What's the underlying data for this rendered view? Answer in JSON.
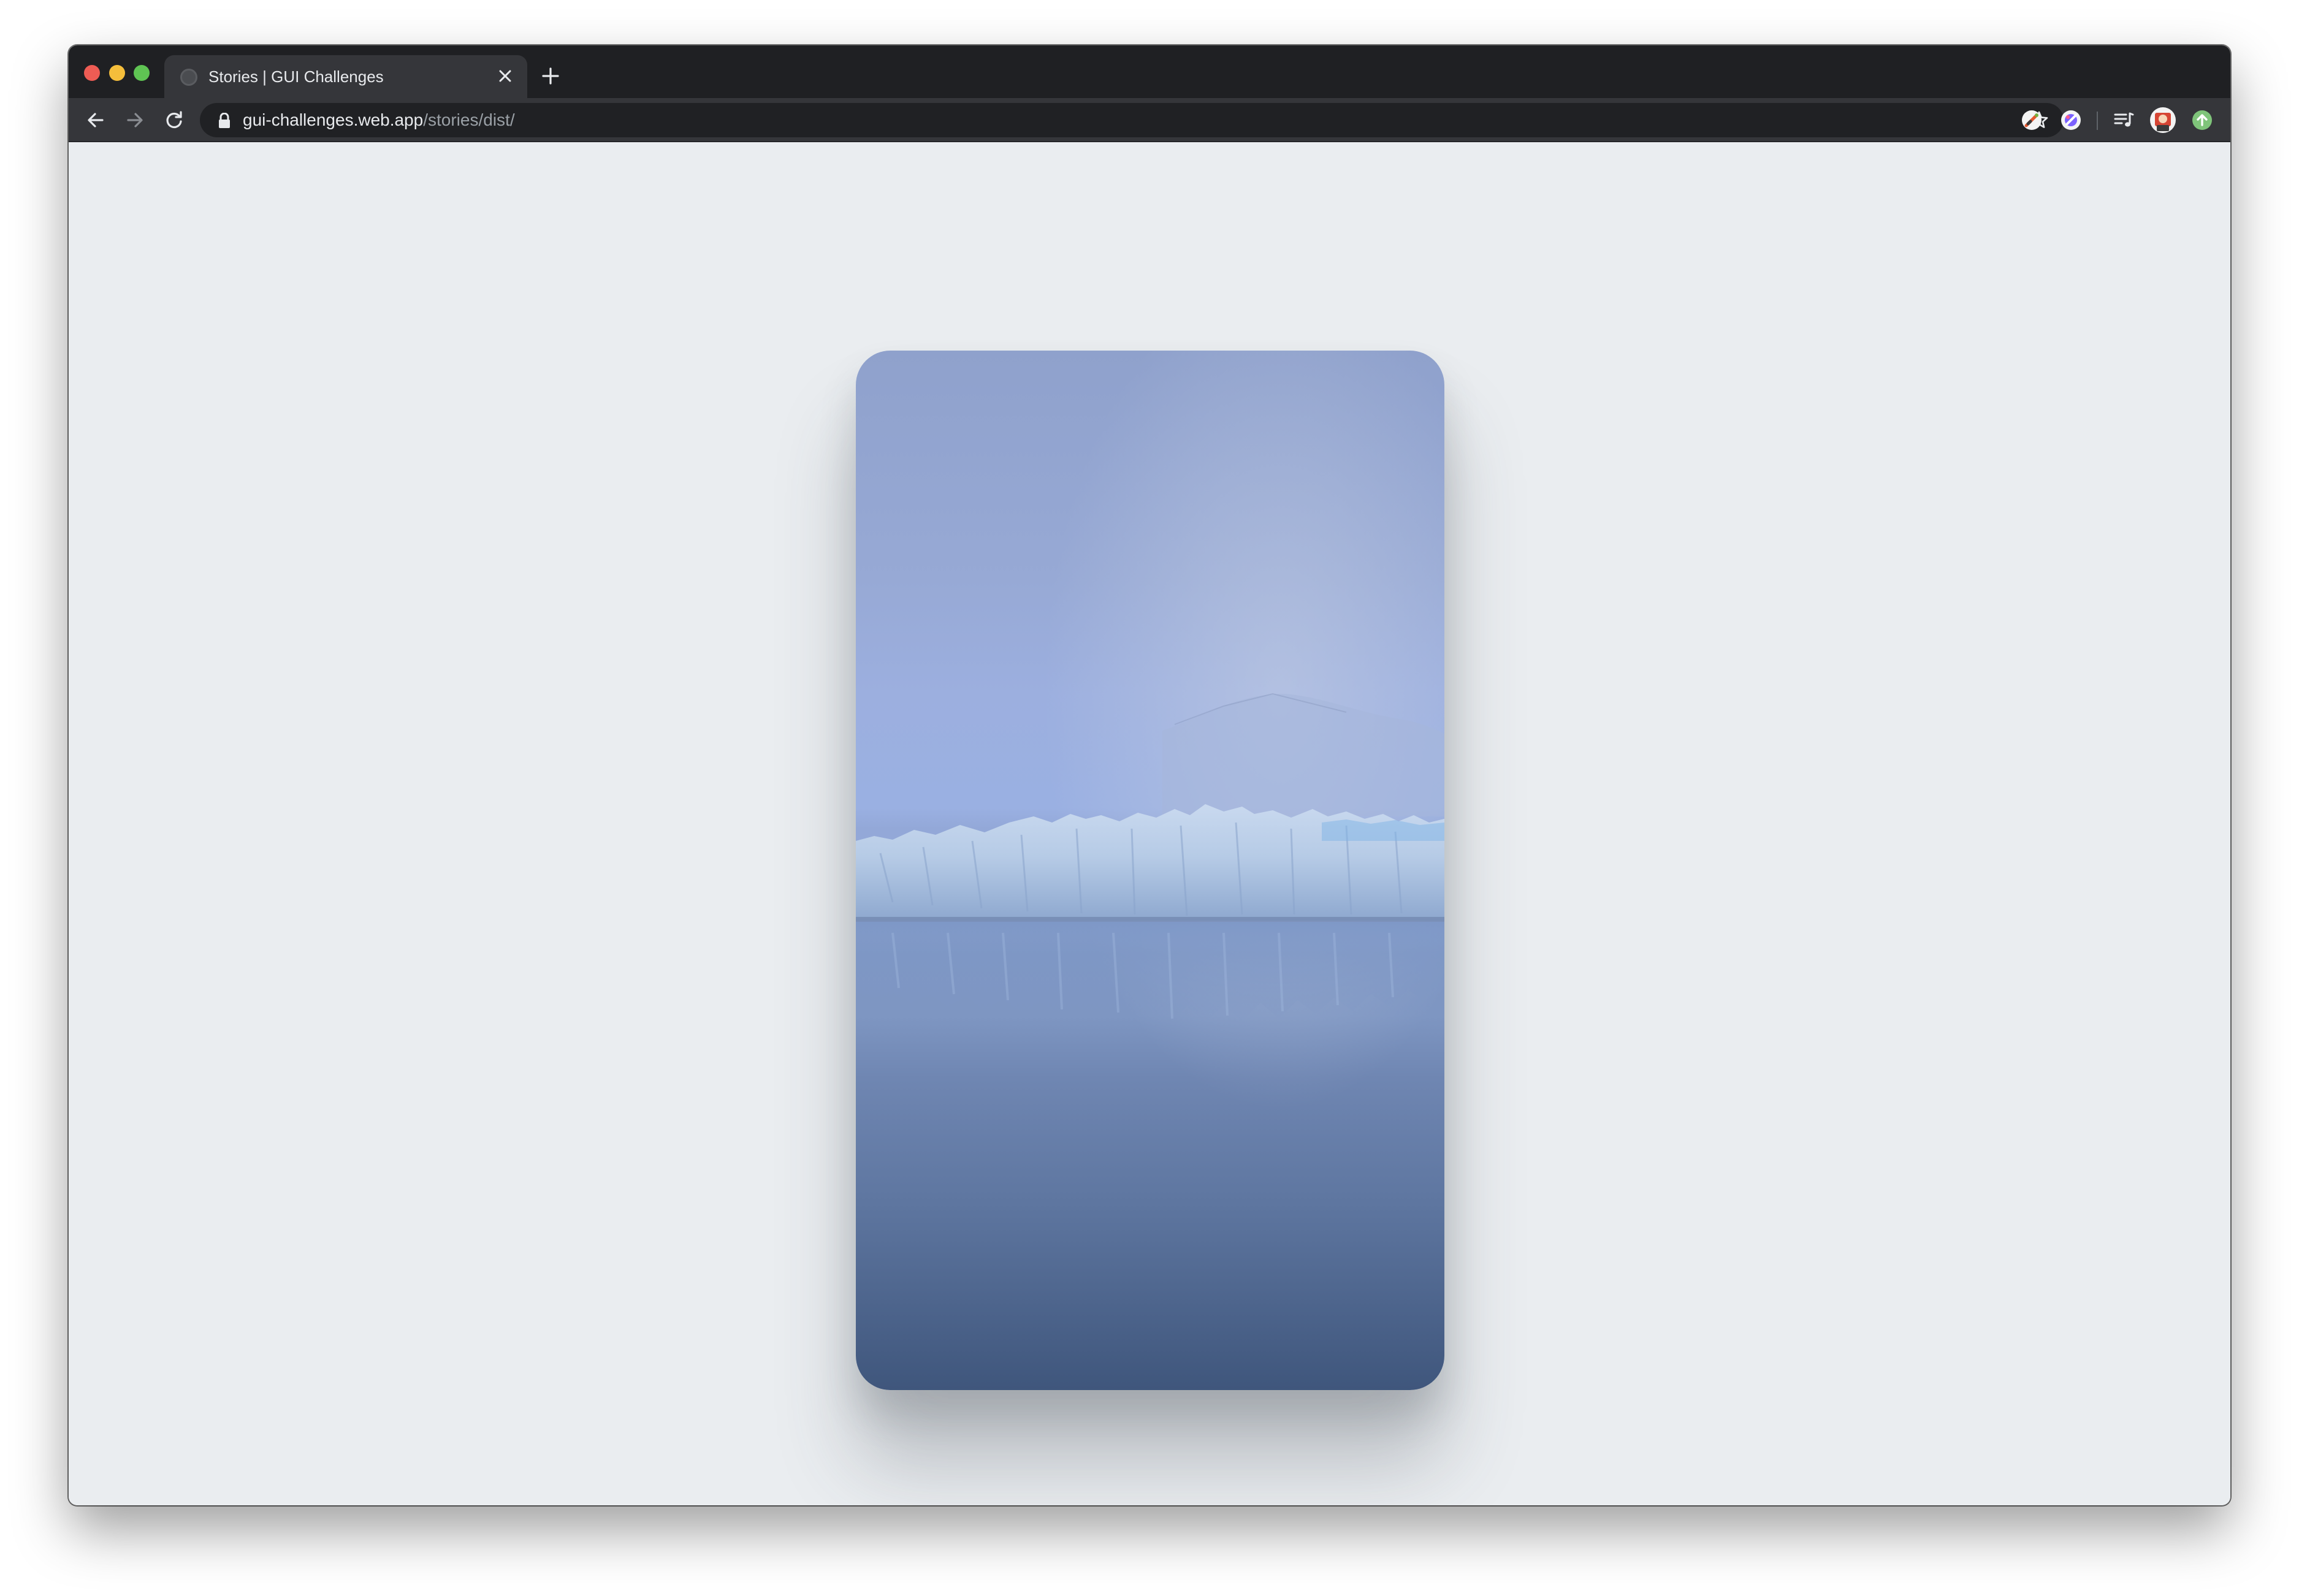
{
  "browser": {
    "tab": {
      "title": "Stories | GUI Challenges",
      "close_icon": "close-icon",
      "favicon_icon": "globe-icon"
    },
    "new_tab_icon": "plus-icon",
    "toolbar": {
      "back_icon": "arrow-left-icon",
      "forward_icon": "arrow-right-icon",
      "reload_icon": "reload-icon",
      "lock_icon": "lock-icon",
      "bookmark_icon": "star-icon",
      "extensions": [
        "color-picker-extension-icon",
        "paint-extension-icon",
        "media-queue-icon",
        "profile-avatar",
        "update-icon"
      ]
    },
    "address": {
      "host": "gui-challenges.web.app",
      "path": "/stories/dist/"
    }
  },
  "page": {
    "background": "#eaedf0",
    "story": {
      "subject": "glacier-with-reflection-image",
      "colors": {
        "sky": "#97a9d5",
        "ice": "#b9cde6",
        "water_dark": "#3f567c"
      }
    }
  }
}
